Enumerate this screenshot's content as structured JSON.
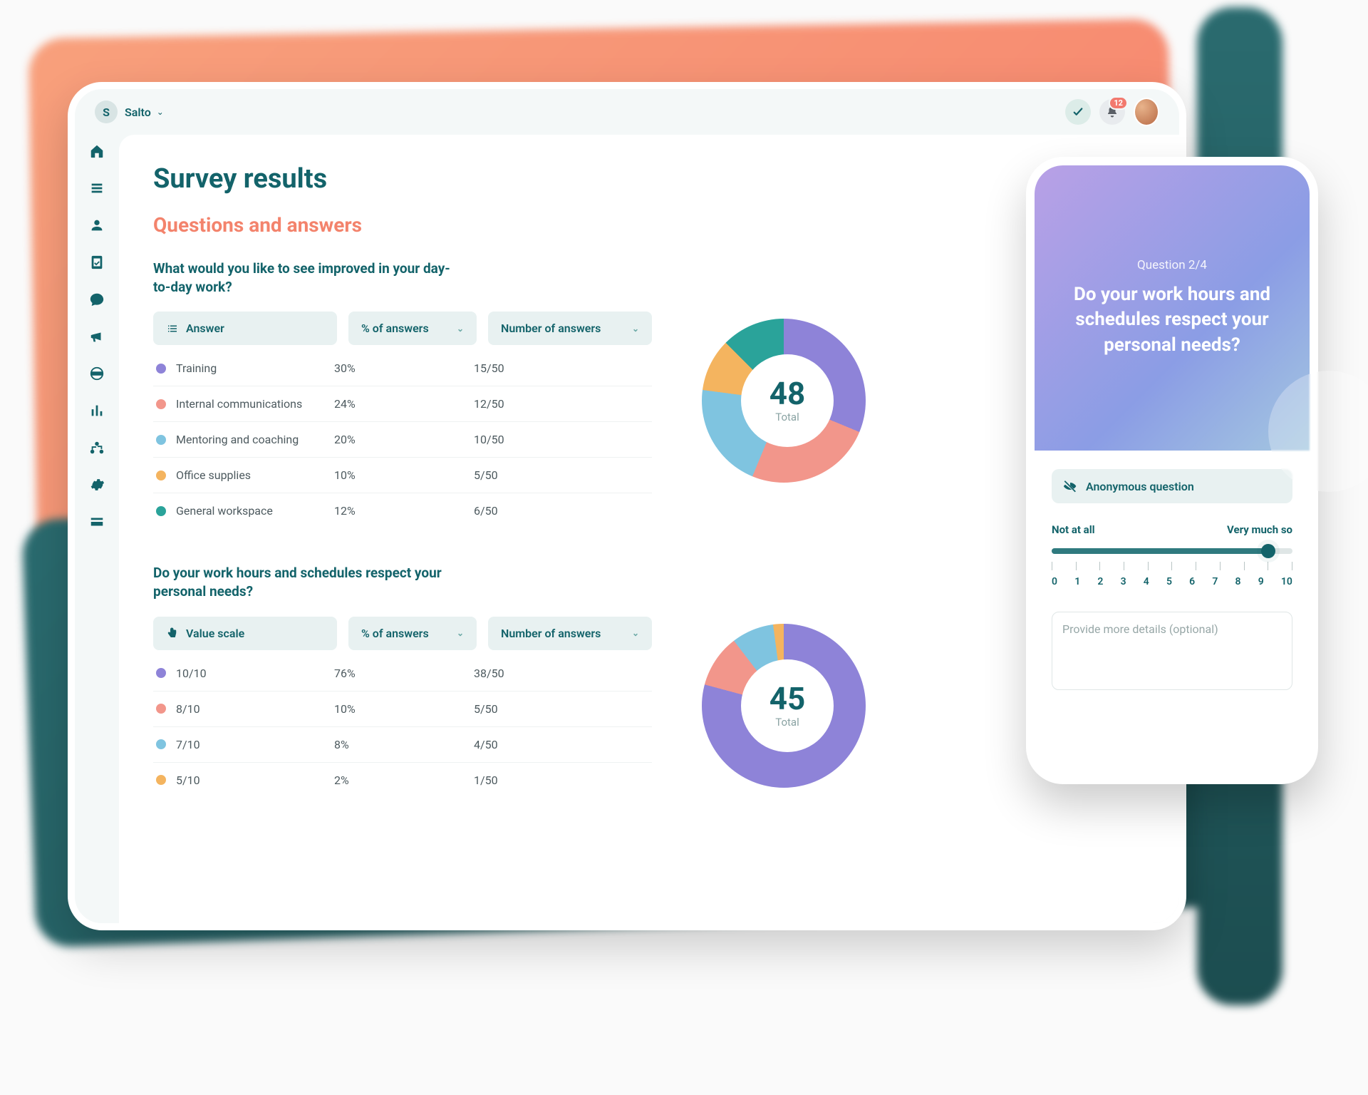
{
  "org": {
    "initial": "S",
    "name": "Salto"
  },
  "notifications": {
    "count": "12"
  },
  "page": {
    "title": "Survey results",
    "subhead": "Questions and answers"
  },
  "columns": {
    "answer": "Answer",
    "valueScale": "Value scale",
    "pct": "% of answers",
    "num": "Number of answers"
  },
  "q1": {
    "title": "What would you like to see improved in your day-to-day work?",
    "rows": [
      {
        "color": "#8e83d8",
        "label": "Training",
        "pct": "30%",
        "num": "15/50"
      },
      {
        "color": "#f2968b",
        "label": "Internal communications",
        "pct": "24%",
        "num": "12/50"
      },
      {
        "color": "#7fc4e0",
        "label": "Mentoring and coaching",
        "pct": "20%",
        "num": "10/50"
      },
      {
        "color": "#f4b45f",
        "label": "Office supplies",
        "pct": "10%",
        "num": "5/50"
      },
      {
        "color": "#2aa39a",
        "label": "General workspace",
        "pct": "12%",
        "num": "6/50"
      }
    ],
    "donut": {
      "total": "48",
      "label": "Total"
    }
  },
  "q2": {
    "title": "Do your work hours and schedules respect your personal needs?",
    "rows": [
      {
        "color": "#8e83d8",
        "label": "10/10",
        "pct": "76%",
        "num": "38/50"
      },
      {
        "color": "#f2968b",
        "label": "8/10",
        "pct": "10%",
        "num": "5/50"
      },
      {
        "color": "#7fc4e0",
        "label": "7/10",
        "pct": "8%",
        "num": "4/50"
      },
      {
        "color": "#f4b45f",
        "label": "5/10",
        "pct": "2%",
        "num": "1/50"
      }
    ],
    "donut": {
      "total": "45",
      "label": "Total"
    }
  },
  "phone": {
    "step": "Question 2/4",
    "question": "Do your work hours and schedules respect your personal needs?",
    "anon": "Anonymous question",
    "scaleLow": "Not at all",
    "scaleHigh": "Very much so",
    "scaleNums": [
      "0",
      "1",
      "2",
      "3",
      "4",
      "5",
      "6",
      "7",
      "8",
      "9",
      "10"
    ],
    "detailsPlaceholder": "Provide more details (optional)"
  },
  "chart_data": [
    {
      "type": "pie",
      "title": "What would you like to see improved in your day-to-day work?",
      "categories": [
        "Training",
        "Internal communications",
        "Mentoring and coaching",
        "Office supplies",
        "General workspace"
      ],
      "values": [
        30,
        24,
        20,
        10,
        12
      ],
      "total_respondents": 48,
      "colors": [
        "#8e83d8",
        "#f2968b",
        "#7fc4e0",
        "#f4b45f",
        "#2aa39a"
      ]
    },
    {
      "type": "pie",
      "title": "Do your work hours and schedules respect your personal needs?",
      "categories": [
        "10/10",
        "8/10",
        "7/10",
        "5/10"
      ],
      "values": [
        76,
        10,
        8,
        2
      ],
      "total_respondents": 45,
      "colors": [
        "#8e83d8",
        "#f2968b",
        "#7fc4e0",
        "#f4b45f"
      ]
    }
  ]
}
